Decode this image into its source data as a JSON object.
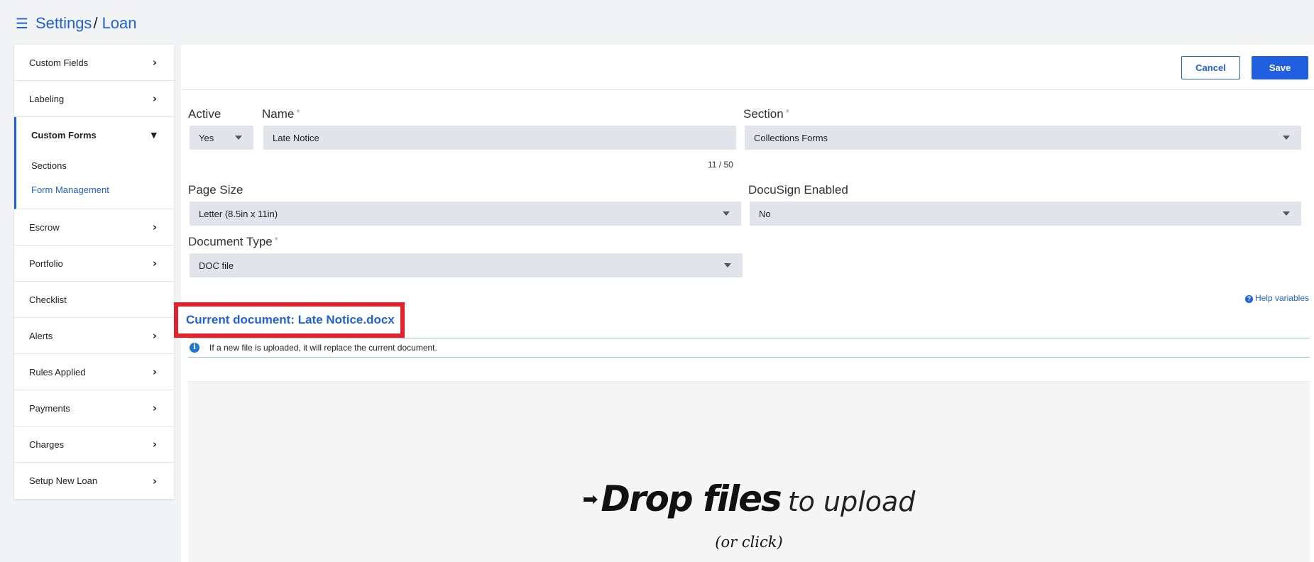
{
  "breadcrumb": {
    "root": "Settings",
    "separator": "/",
    "current": "Loan"
  },
  "sidebar": {
    "items": [
      {
        "label": "Custom Fields"
      },
      {
        "label": "Labeling"
      },
      {
        "label": "Custom Forms",
        "expanded": true,
        "children": [
          "Sections",
          "Form Management"
        ]
      },
      {
        "label": "Escrow"
      },
      {
        "label": "Portfolio"
      },
      {
        "label": "Checklist"
      },
      {
        "label": "Alerts"
      },
      {
        "label": "Rules Applied"
      },
      {
        "label": "Payments"
      },
      {
        "label": "Charges"
      },
      {
        "label": "Setup New Loan"
      }
    ],
    "active_child": "Form Management"
  },
  "toolbar": {
    "cancel_label": "Cancel",
    "save_label": "Save"
  },
  "form": {
    "active": {
      "label": "Active",
      "value": "Yes"
    },
    "name": {
      "label": "Name",
      "required_mark": "*",
      "value": "Late Notice",
      "counter": "11 / 50"
    },
    "section": {
      "label": "Section",
      "required_mark": "*",
      "value": "Collections Forms"
    },
    "page_size": {
      "label": "Page Size",
      "value": "Letter (8.5in x 11in)"
    },
    "docusign": {
      "label": "DocuSign Enabled",
      "value": "No"
    },
    "document_type": {
      "label": "Document Type",
      "required_mark": "*",
      "value": "DOC file"
    }
  },
  "help_variables": "Help variables",
  "current_document": "Current document: Late Notice.docx",
  "info_message": "If a new file is uploaded, it will replace the current document.",
  "dropzone": {
    "strong": "Drop files",
    "light": "to upload",
    "sub": "(or click)"
  },
  "colors": {
    "accent": "#1f5fe0",
    "highlight_border": "#e3222e",
    "field_bg": "#e1e4ea"
  }
}
